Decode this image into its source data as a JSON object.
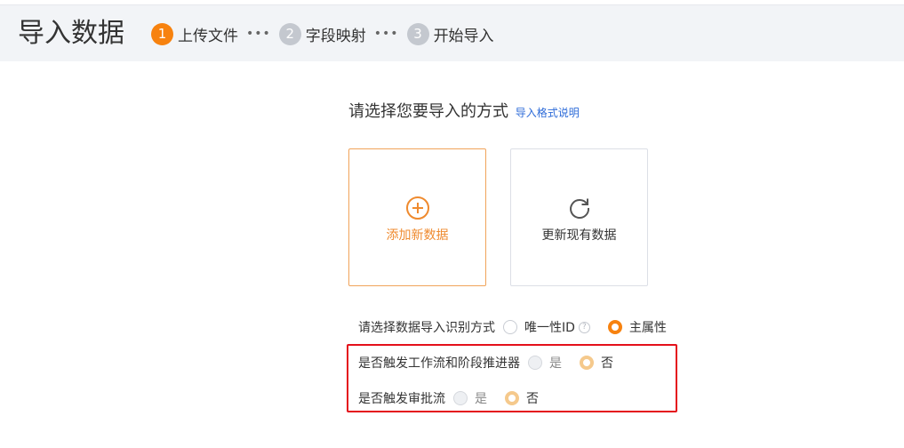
{
  "header": {
    "title": "导入数据",
    "steps": [
      {
        "num": "1",
        "label": "上传文件"
      },
      {
        "num": "2",
        "label": "字段映射"
      },
      {
        "num": "3",
        "label": "开始导入"
      }
    ],
    "separator": "•••"
  },
  "main": {
    "prompt": "请选择您要导入的方式",
    "format_link": "导入格式说明",
    "cards": [
      {
        "label": "添加新数据",
        "icon": "plus-circle-icon"
      },
      {
        "label": "更新现有数据",
        "icon": "refresh-icon"
      }
    ],
    "identify": {
      "label": "请选择数据导入识别方式",
      "options": [
        "唯一性ID",
        "主属性"
      ],
      "selected": "主属性",
      "help": "?"
    },
    "workflow": {
      "label": "是否触发工作流和阶段推进器",
      "options": [
        "是",
        "否"
      ],
      "selected": "否"
    },
    "approval": {
      "label": "是否触发审批流",
      "options": [
        "是",
        "否"
      ],
      "selected": "否"
    }
  },
  "colors": {
    "accent": "#f7820f",
    "link": "#2d6bd8",
    "highlight_border": "#e4101b"
  }
}
